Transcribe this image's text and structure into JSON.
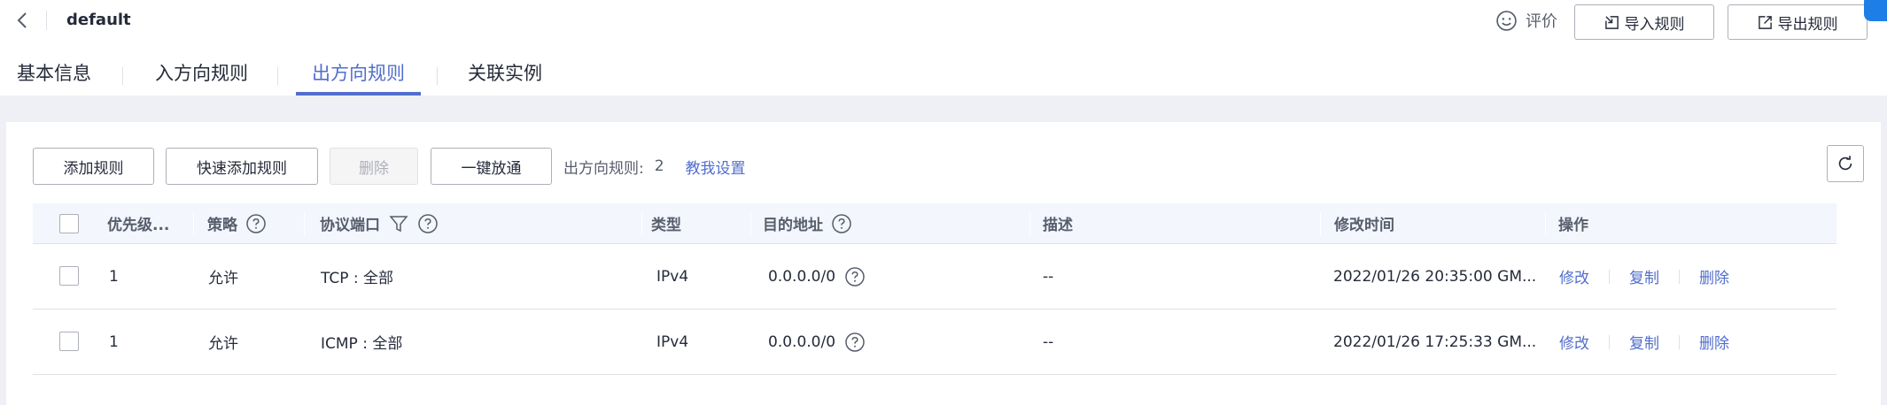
{
  "header": {
    "title": "default",
    "back_icon": "chevron-left-icon",
    "rate_label": "评价",
    "rate_icon": "smile-icon",
    "import_label": "导入规则",
    "import_icon": "import-icon",
    "export_label": "导出规则",
    "export_icon": "export-icon"
  },
  "tabs": [
    {
      "label": "基本信息",
      "active": false
    },
    {
      "label": "入方向规则",
      "active": false
    },
    {
      "label": "出方向规则",
      "active": true
    },
    {
      "label": "关联实例",
      "active": false
    }
  ],
  "toolbar": {
    "add_label": "添加规则",
    "quick_add_label": "快速添加规则",
    "delete_label": "删除",
    "allow_all_label": "一键放通",
    "rules_count_label": "出方向规则:",
    "rules_count": "2",
    "help_link": "教我设置",
    "refresh_icon": "refresh-icon"
  },
  "table": {
    "columns": {
      "priority": "优先级...",
      "policy": "策略",
      "protocol_port": "协议端口",
      "type": "类型",
      "destination": "目的地址",
      "description": "描述",
      "modified": "修改时间",
      "actions": "操作"
    },
    "rows": [
      {
        "priority": "1",
        "policy": "允许",
        "protocol_port": "TCP : 全部",
        "type": "IPv4",
        "destination": "0.0.0.0/0",
        "description": "--",
        "modified": "2022/01/26 20:35:00 GM...",
        "edit": "修改",
        "copy": "复制",
        "delete": "删除"
      },
      {
        "priority": "1",
        "policy": "允许",
        "protocol_port": "ICMP : 全部",
        "type": "IPv4",
        "destination": "0.0.0.0/0",
        "description": "--",
        "modified": "2022/01/26 17:25:33 GM...",
        "edit": "修改",
        "copy": "复制",
        "delete": "删除"
      }
    ]
  },
  "colors": {
    "accent": "#526ecc",
    "text": "#252b3a",
    "muted": "#575d6c",
    "header_bg": "#f3f6fd",
    "page_bg": "#eef0f5"
  }
}
